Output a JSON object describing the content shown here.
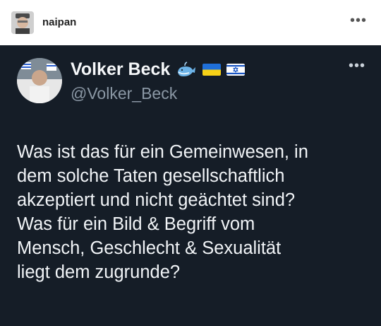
{
  "top_bar": {
    "username": "naipan",
    "more_icon": "ellipsis-horizontal-icon"
  },
  "tweet": {
    "author_name": "Volker Beck",
    "handle": "@Volker_Beck",
    "badges": [
      "whale-emoji-icon",
      "ukraine-flag-icon",
      "israel-flag-icon"
    ],
    "more_icon": "ellipsis-horizontal-icon",
    "text": "Was ist das für ein Gemeinwesen, in\ndem solche Taten gesellschaftlich\nakzeptiert und nicht geächtet sind?\nWas für ein Bild & Begriff vom\nMensch, Geschlecht & Sexualität\nliegt dem zugrunde?"
  },
  "colors": {
    "tweet_background": "#151d27",
    "handle": "#8b98a5",
    "accent": "#f0524f"
  }
}
